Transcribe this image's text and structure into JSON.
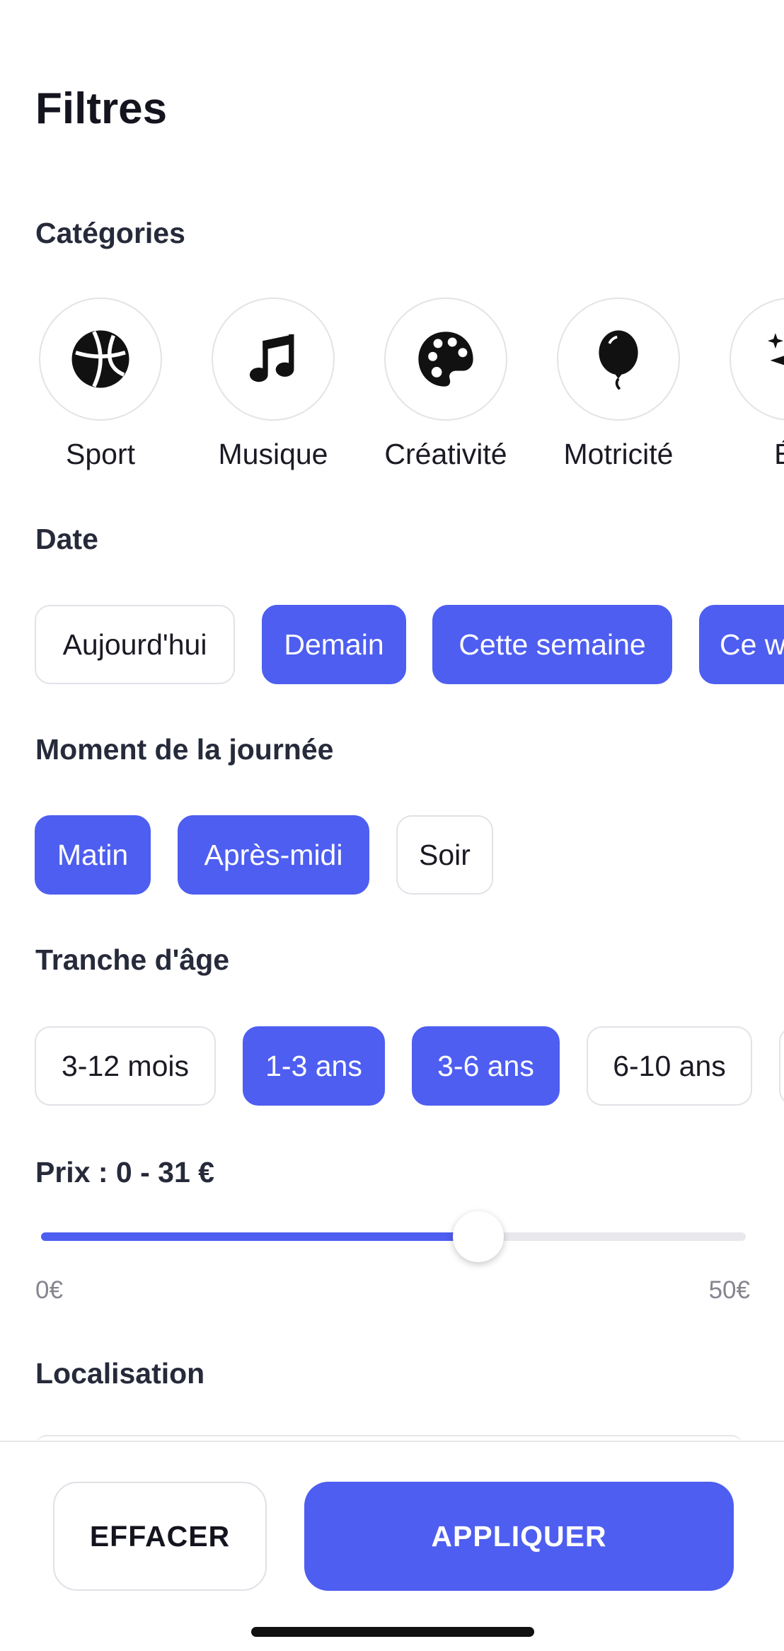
{
  "title": "Filtres",
  "categories": {
    "label": "Catégories",
    "items": [
      {
        "label": "Sport",
        "icon": "basketball-icon"
      },
      {
        "label": "Musique",
        "icon": "music-note-icon"
      },
      {
        "label": "Créativité",
        "icon": "palette-icon"
      },
      {
        "label": "Motricité",
        "icon": "balloon-icon"
      },
      {
        "label": "Év",
        "icon": "sparkles-icon"
      }
    ]
  },
  "date": {
    "label": "Date",
    "chips": [
      {
        "label": "Aujourd'hui",
        "selected": false
      },
      {
        "label": "Demain",
        "selected": true
      },
      {
        "label": "Cette semaine",
        "selected": true
      },
      {
        "label": "Ce w",
        "selected": true
      }
    ]
  },
  "moment": {
    "label": "Moment de la journée",
    "chips": [
      {
        "label": "Matin",
        "selected": true
      },
      {
        "label": "Après-midi",
        "selected": true
      },
      {
        "label": "Soir",
        "selected": false
      }
    ]
  },
  "age": {
    "label": "Tranche d'âge",
    "chips": [
      {
        "label": "3-12 mois",
        "selected": false
      },
      {
        "label": "1-3 ans",
        "selected": true
      },
      {
        "label": "3-6 ans",
        "selected": true
      },
      {
        "label": "6-10 ans",
        "selected": false
      }
    ]
  },
  "price": {
    "label": "Prix : 0 - 31 €",
    "min_label": "0€",
    "max_label": "50€",
    "min": 0,
    "max": 50,
    "value": 31
  },
  "location": {
    "label": "Localisation"
  },
  "actions": {
    "clear": "EFFACER",
    "apply": "APPLIQUER"
  },
  "colors": {
    "accent": "#4e5ef0",
    "text": "#14141f",
    "border": "#e2e2e8"
  }
}
